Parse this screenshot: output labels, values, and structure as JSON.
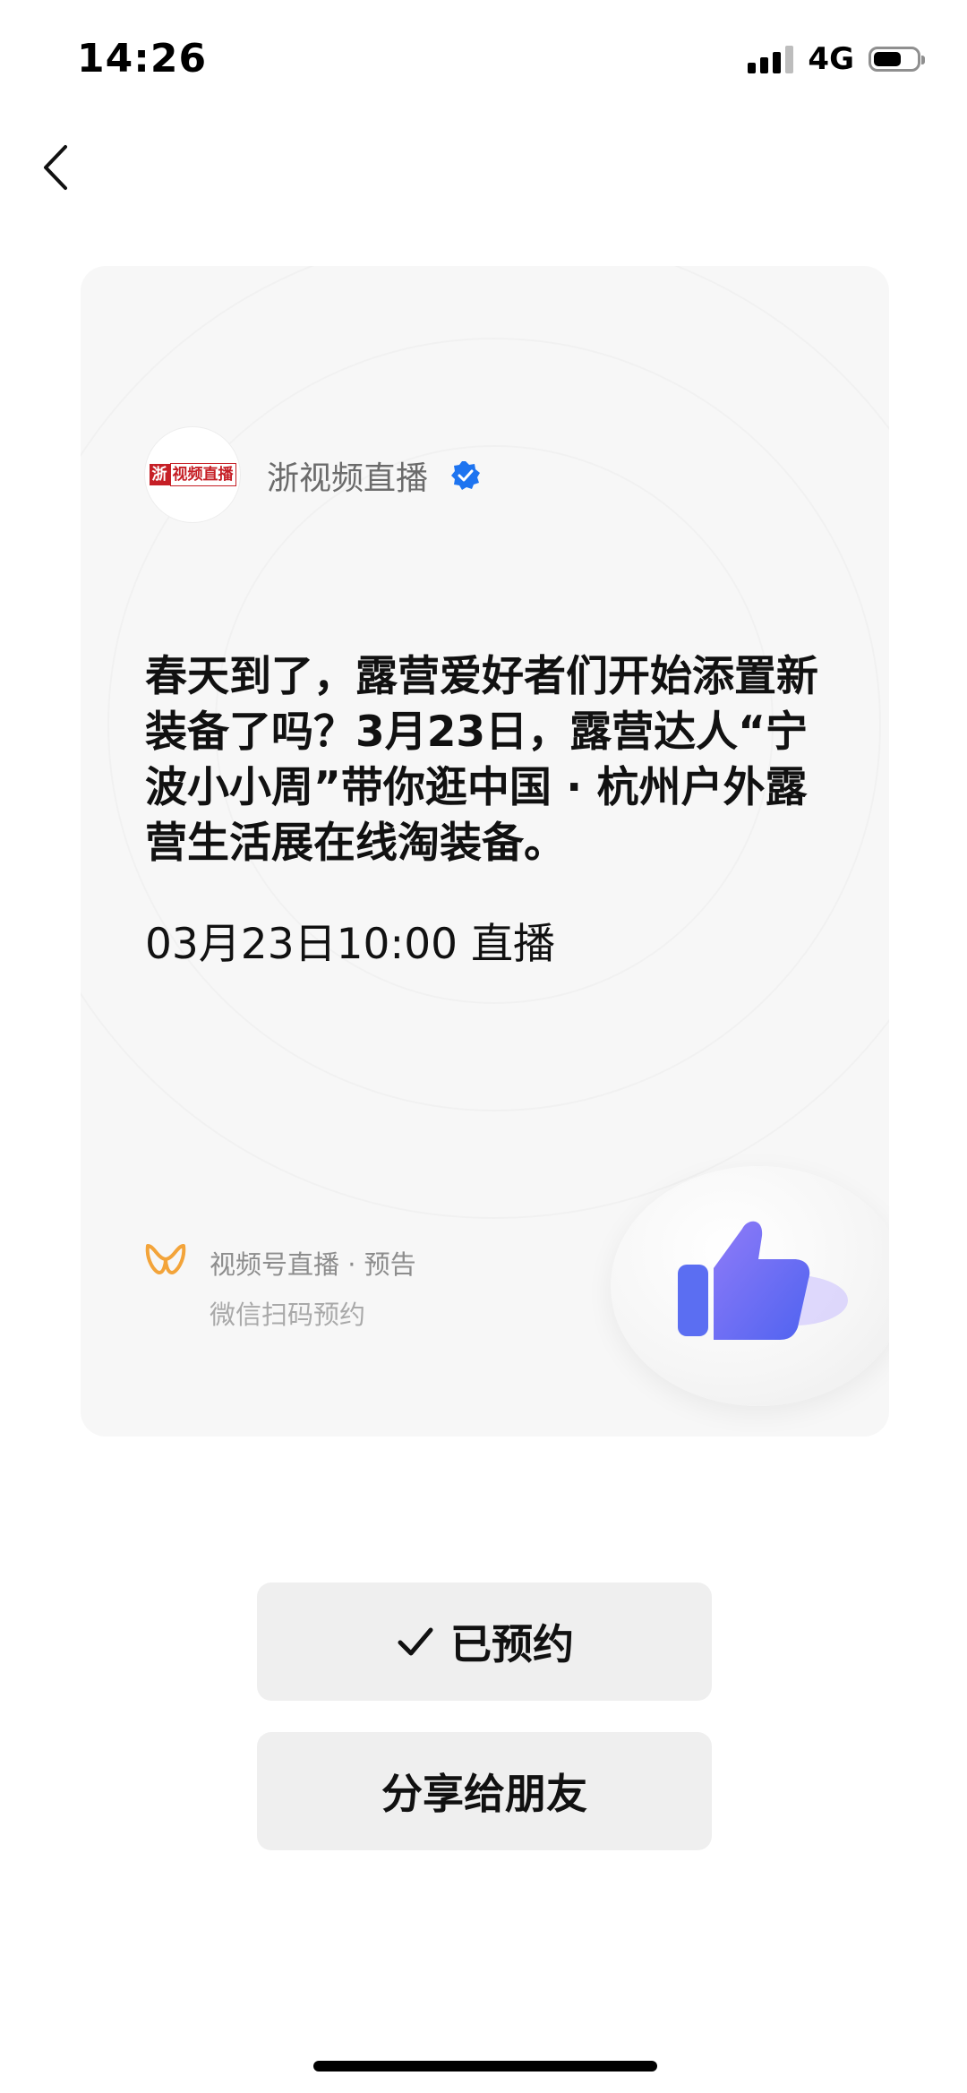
{
  "status_bar": {
    "time": "14:26",
    "network": "4G"
  },
  "card": {
    "account_name": "浙视频直播",
    "avatar_logo_text": [
      "浙",
      "视频直播"
    ],
    "description": "春天到了，露营爱好者们开始添置新装备了吗？3月23日，露营达人“宁波小小周”带你逛中国 · 杭州户外露营生活展在线淘装备。",
    "schedule": "03月23日10:00 直播",
    "footer_title": "视频号直播 · 预告",
    "footer_subtitle": "微信扫码预约"
  },
  "buttons": {
    "reserved_label": "已预约",
    "share_label": "分享给朋友"
  },
  "colors": {
    "verified_blue": "#1e74f0",
    "logo_orange": "#f3a43a",
    "thumb_purple": "#7a6cf5"
  },
  "icons": {
    "back": "chevron-left-icon",
    "verified": "verified-badge-icon",
    "channels": "wechat-channels-icon",
    "like": "thumbs-up-icon",
    "check": "check-icon"
  }
}
